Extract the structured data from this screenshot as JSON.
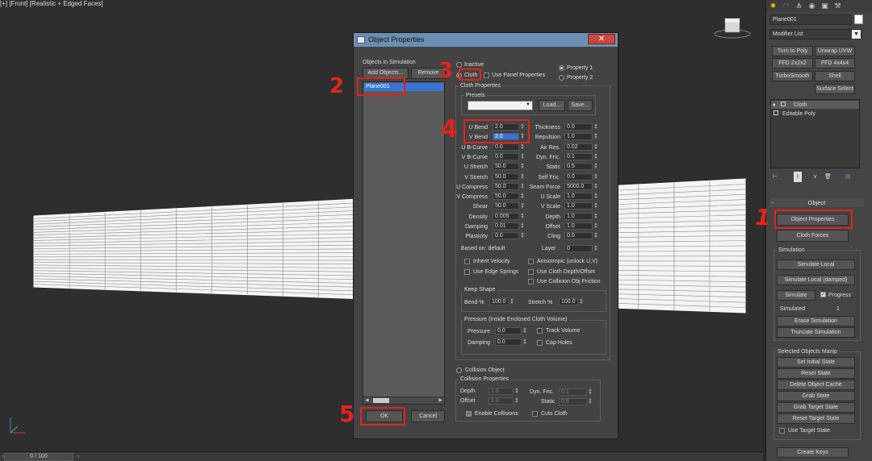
{
  "viewport": {
    "label": "[+] [Front] [Realistic + Edged Faces]",
    "viewcube_label": "",
    "timeslider": "0 / 100"
  },
  "command_panel": {
    "object_name": "Plane001",
    "modifier_list": "Modifier List",
    "modifier_buttons": [
      "Turn to Poly",
      "Unwrap UVW",
      "FFD 2x2x2",
      "FFD 4x4x4",
      "TurboSmooth",
      "Shell",
      "Surface Select"
    ],
    "stack": [
      "Cloth",
      "Editable Poly"
    ],
    "object_rollout": "Object",
    "object_properties": "Object Properties",
    "cloth_forces": "Cloth Forces",
    "simulation_group": "Simulation",
    "simulate_local": "Simulate Local",
    "simulate_local_damped": "Simulate Local (damped)",
    "simulate": "Simulate",
    "progress": "Progress",
    "simulated_label": "Simulated",
    "simulated_value": "1",
    "erase_simulation": "Erase Simulation",
    "truncate_simulation": "Truncate Simulation",
    "selected_objects_group": "Selected Objects Manip",
    "set_initial_state": "Set Initial State",
    "reset_state": "Reset State",
    "delete_object_cache": "Delete Object Cache",
    "grab_state": "Grab State",
    "grab_target_state": "Grab Target State",
    "reset_target_state": "Reset Target State",
    "use_target_state": "Use Target State",
    "create_keys": "Create Keys"
  },
  "dialog": {
    "title": "Object Properties",
    "close": "✕",
    "objects_in_simulation": "Objects in Simulation",
    "add_objects": "Add Objects...",
    "remove": "Remove",
    "list_items": [
      "Plane001"
    ],
    "ok": "OK",
    "cancel": "Cancel",
    "inactive": "Inactive",
    "cloth": "Cloth",
    "use_panel_properties": "Use Panel Properties",
    "property1": "Property 1",
    "property2": "Property 2",
    "cloth_properties": "Cloth Properties",
    "presets": "Presets",
    "load": "Load...",
    "save": "Save...",
    "left_fields": [
      {
        "label": "U Bend",
        "value": "2.0"
      },
      {
        "label": "V Bend",
        "value": "2.0"
      },
      {
        "label": "U B-Curve",
        "value": "0.0"
      },
      {
        "label": "V B-Curve",
        "value": "0.0"
      },
      {
        "label": "U Stretch",
        "value": "50.0"
      },
      {
        "label": "V Stretch",
        "value": "50.0"
      },
      {
        "label": "U Compress",
        "value": "50.0"
      },
      {
        "label": "V Compress",
        "value": "50.0"
      },
      {
        "label": "Shear",
        "value": "50.0"
      },
      {
        "label": "Density",
        "value": "0.005"
      },
      {
        "label": "Damping",
        "value": "0.01"
      },
      {
        "label": "Plasticity",
        "value": "0.0"
      }
    ],
    "right_fields": [
      {
        "label": "Thickness",
        "value": "0.0"
      },
      {
        "label": "Repulsion",
        "value": "1.0"
      },
      {
        "label": "Air Res.",
        "value": "0.02"
      },
      {
        "label": "Dyn. Fric.",
        "value": "0.1"
      },
      {
        "label": "Static",
        "value": "0.5"
      },
      {
        "label": "Self Fric.",
        "value": "0.0"
      },
      {
        "label": "Seam Force",
        "value": "5000.0"
      },
      {
        "label": "U Scale",
        "value": "1.0"
      },
      {
        "label": "V Scale",
        "value": "1.0"
      },
      {
        "label": "Depth",
        "value": "1.0"
      },
      {
        "label": "Offset",
        "value": "1.0"
      },
      {
        "label": "Cling",
        "value": "0.0"
      }
    ],
    "based_on": "Based on: default",
    "layer_label": "Layer",
    "layer_value": "0",
    "inherit_velocity": "Inherit Velocity",
    "anisotropic": "Anisotropic (unlock U,V)",
    "use_edge_springs": "Use Edge Springs",
    "use_cloth_depth": "Use Cloth Depth/Offset",
    "use_collision_friction": "Use Collision Obj Friction",
    "keep_shape": "Keep Shape",
    "bend_label": "Bend %",
    "bend_value": "100.0",
    "stretch_label": "Stretch %",
    "stretch_value": "100.0",
    "pressure_group": "Pressure (Inside Enclosed Cloth Volume)",
    "pressure_label": "Pressure",
    "pressure_value": "0.0",
    "pdamping_label": "Damping",
    "pdamping_value": "0.0",
    "track_volume": "Track Volume",
    "cap_holes": "Cap Holes",
    "collision_object": "Collision Object",
    "collision_properties": "Collision Properties",
    "c_depth_label": "Depth",
    "c_depth_value": "1.0",
    "c_offset_label": "Offset",
    "c_offset_value": "1.0",
    "c_dynfric_label": "Dyn. Fric.",
    "c_dynfric_value": "0.1",
    "c_static_label": "Static",
    "c_static_value": "0.5",
    "enable_collisions": "Enable Collisions",
    "cuts_cloth": "Cuts Cloth"
  },
  "annotations": [
    "1",
    "2",
    "3",
    "4",
    "5"
  ],
  "colors": {
    "annotation": "#e2231a",
    "selection": "#3875d7",
    "titlebar": "#6b8fb3",
    "close": "#c9463d"
  }
}
